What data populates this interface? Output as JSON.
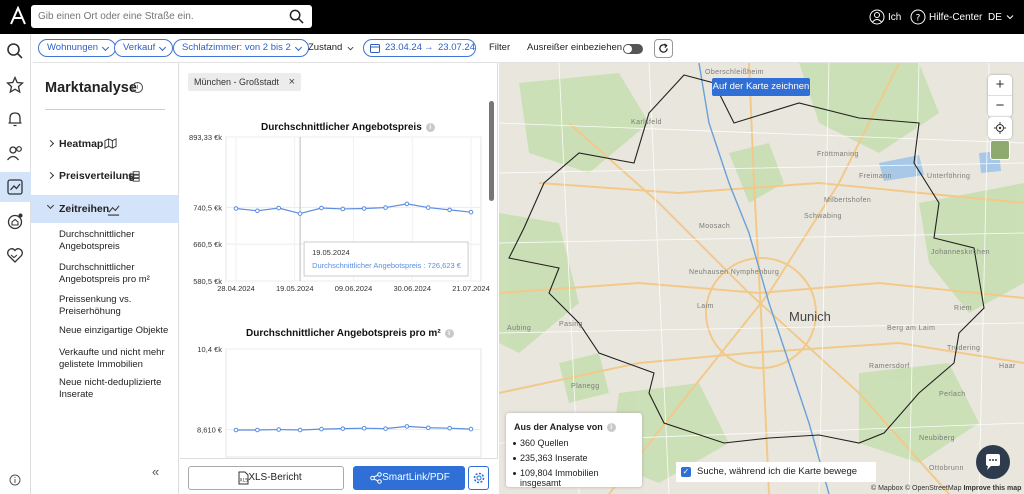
{
  "topbar": {
    "search_placeholder": "Gib einen Ort oder eine Straße ein.",
    "user_label": "Ich",
    "help_label": "Hilfe-Center",
    "language": "DE"
  },
  "filters": {
    "property_type": "Wohnungen",
    "transaction": "Verkauf",
    "rooms": "Schlafzimmer: von 2 bis 2",
    "condition": "Zustand",
    "date_from": "23.04.24",
    "date_to": "23.07.24",
    "filter_label": "Filter",
    "outliers_label": "Ausreißer einbeziehen",
    "outliers_enabled": false
  },
  "sidebar": {
    "title": "Marktanalyse",
    "info_icon": "i",
    "nav": [
      {
        "label": "Heatmap",
        "icon": "heatmap-icon",
        "expanded": false
      },
      {
        "label": "Preisverteilung",
        "icon": "price-distribution-icon",
        "expanded": false
      },
      {
        "label": "Zeitreihen",
        "icon": "timeseries-icon",
        "expanded": true
      }
    ],
    "sub_items": [
      "Durchschnittlicher Angebotspreis",
      "Durchschnittlicher Angebotspreis pro m²",
      "Preissenkung vs. Preiserhöhung",
      "Neue einzigartige Objekte",
      "Verkaufte und nicht mehr gelistete Immobilien",
      "Neue nicht-deduplizierte Inserate"
    ],
    "collapse": "«"
  },
  "location_tag": "München - Großstadt",
  "chart_data": [
    {
      "type": "line",
      "title": "Durchschnittlicher Angebotspreis",
      "xlabel": "",
      "ylabel": "",
      "x_ticks": [
        "28.04.2024",
        "19.05.2024",
        "09.06.2024",
        "30.06.2024",
        "21.07.2024"
      ],
      "y_ticks": [
        "893,33 €k",
        "740,5 €k",
        "660,5 €k",
        "580,5 €k"
      ],
      "y_tick_values": [
        893.33,
        740.5,
        660.5,
        580.5
      ],
      "ylim": [
        580.5,
        893.33
      ],
      "series": [
        {
          "values": [
            738,
            733,
            739,
            727,
            739,
            737,
            738,
            740,
            748,
            740,
            735,
            730
          ]
        }
      ],
      "tooltip": {
        "date": "19.05.2024",
        "text": "Durchschnittlicher Angebotspreis : 726,623 €"
      },
      "grid": true
    },
    {
      "type": "line",
      "title": "Durchschnittlicher Angebotspreis pro m²",
      "xlabel": "",
      "ylabel": "",
      "y_ticks": [
        "10,4 €k",
        "8,610 €"
      ],
      "y_tick_values": [
        10400,
        8610
      ],
      "ylim": [
        8000,
        10400
      ],
      "series": [
        {
          "values": [
            8600,
            8600,
            8610,
            8600,
            8620,
            8630,
            8640,
            8630,
            8680,
            8650,
            8640,
            8620
          ]
        }
      ],
      "grid": true
    }
  ],
  "buttons": {
    "xls": "XLS-Bericht",
    "share": "SmartLink/PDF"
  },
  "map": {
    "draw_button": "Auf der Karte zeichnen",
    "city_label": "Munich",
    "district_labels": [
      "Karlsfeld",
      "Moosach",
      "Schwabing",
      "Neuhausen Nymphenburg",
      "Laim",
      "Pasing",
      "Planegg",
      "Haar",
      "Trudering",
      "Berg am Laim",
      "Ottobrunn",
      "Unterföhring",
      "Milbertshofen",
      "Fröttmaning",
      "Ramersdorf",
      "Perlach",
      "Neubiberg",
      "Riem",
      "Johanneskirchen",
      "Freimann",
      "Aubing",
      "Oberschleißheim"
    ],
    "analysis_title": "Aus der Analyse von",
    "analysis_items": [
      "360 Quellen",
      "235,363 Inserate",
      "109,804 Immobilien insgesamt"
    ],
    "search_move_label": "Suche, während ich die Karte bewege",
    "search_move_checked": true,
    "attribution": "© Mapbox © OpenStreetMap",
    "improve": "Improve this map",
    "zoom_in": "+",
    "zoom_out": "−"
  },
  "colors": {
    "accent": "#2f6fd6",
    "topbar": "#000000",
    "active_nav": "#d3e3fa",
    "line": "#5b8de0"
  }
}
